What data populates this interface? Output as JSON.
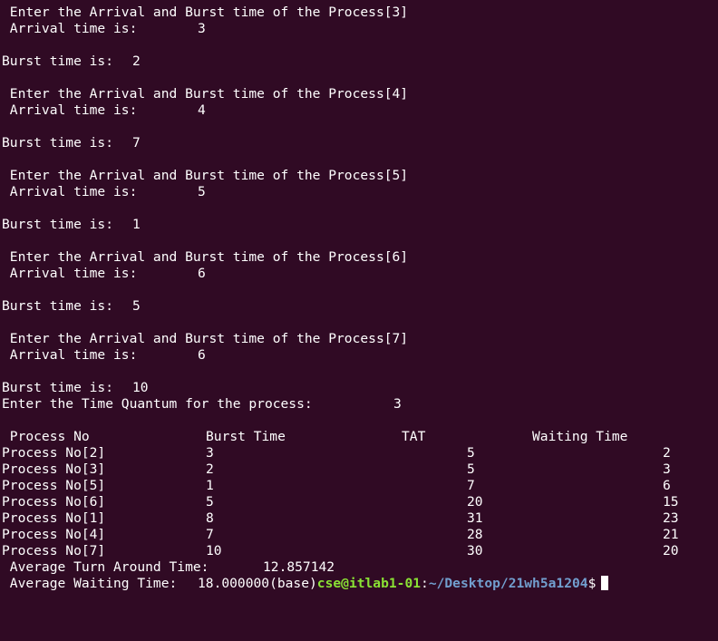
{
  "entries": [
    {
      "header": " Enter the Arrival and Burst time of the Process[3]",
      "arrival_label": " Arrival time is:",
      "arrival_value": "3",
      "burst_label": "Burst time is:",
      "burst_value": "2"
    },
    {
      "header": " Enter the Arrival and Burst time of the Process[4]",
      "arrival_label": " Arrival time is:",
      "arrival_value": "4",
      "burst_label": "Burst time is:",
      "burst_value": "7"
    },
    {
      "header": " Enter the Arrival and Burst time of the Process[5]",
      "arrival_label": " Arrival time is:",
      "arrival_value": "5",
      "burst_label": "Burst time is:",
      "burst_value": "1"
    },
    {
      "header": " Enter the Arrival and Burst time of the Process[6]",
      "arrival_label": " Arrival time is:",
      "arrival_value": "6",
      "burst_label": "Burst time is:",
      "burst_value": "5"
    },
    {
      "header": " Enter the Arrival and Burst time of the Process[7]",
      "arrival_label": " Arrival time is:",
      "arrival_value": "6",
      "burst_label": "Burst time is:",
      "burst_value": "10"
    }
  ],
  "quantum": {
    "label": "Enter the Time Quantum for the process:",
    "value": "3"
  },
  "table": {
    "headers": [
      " Process No",
      "Burst Time",
      "TAT",
      "Waiting Time"
    ],
    "rows": [
      {
        "process": "Process No[2]",
        "burst": "3",
        "tat": "5",
        "waiting": "2"
      },
      {
        "process": "Process No[3]",
        "burst": "2",
        "tat": "5",
        "waiting": "3"
      },
      {
        "process": "Process No[5]",
        "burst": "1",
        "tat": "7",
        "waiting": "6"
      },
      {
        "process": "Process No[6]",
        "burst": "5",
        "tat": "20",
        "waiting": "15"
      },
      {
        "process": "Process No[1]",
        "burst": "8",
        "tat": "31",
        "waiting": "23"
      },
      {
        "process": "Process No[4]",
        "burst": "7",
        "tat": "28",
        "waiting": "21"
      },
      {
        "process": "Process No[7]",
        "burst": "10",
        "tat": "30",
        "waiting": "20"
      }
    ]
  },
  "averages": {
    "tat_label": " Average Turn Around Time:",
    "tat_value": "12.857142",
    "wait_label": " Average Waiting Time:",
    "wait_value": "18.000000(base)"
  },
  "prompt": {
    "user_host": "cse@itlab1-01",
    "separator": ":",
    "path": "~/Desktop/21wh5a1204",
    "symbol": "$"
  },
  "colors": {
    "background": "#300a24",
    "text": "#ffffff",
    "prompt_user": "#8ae234",
    "prompt_path": "#729fcf"
  }
}
